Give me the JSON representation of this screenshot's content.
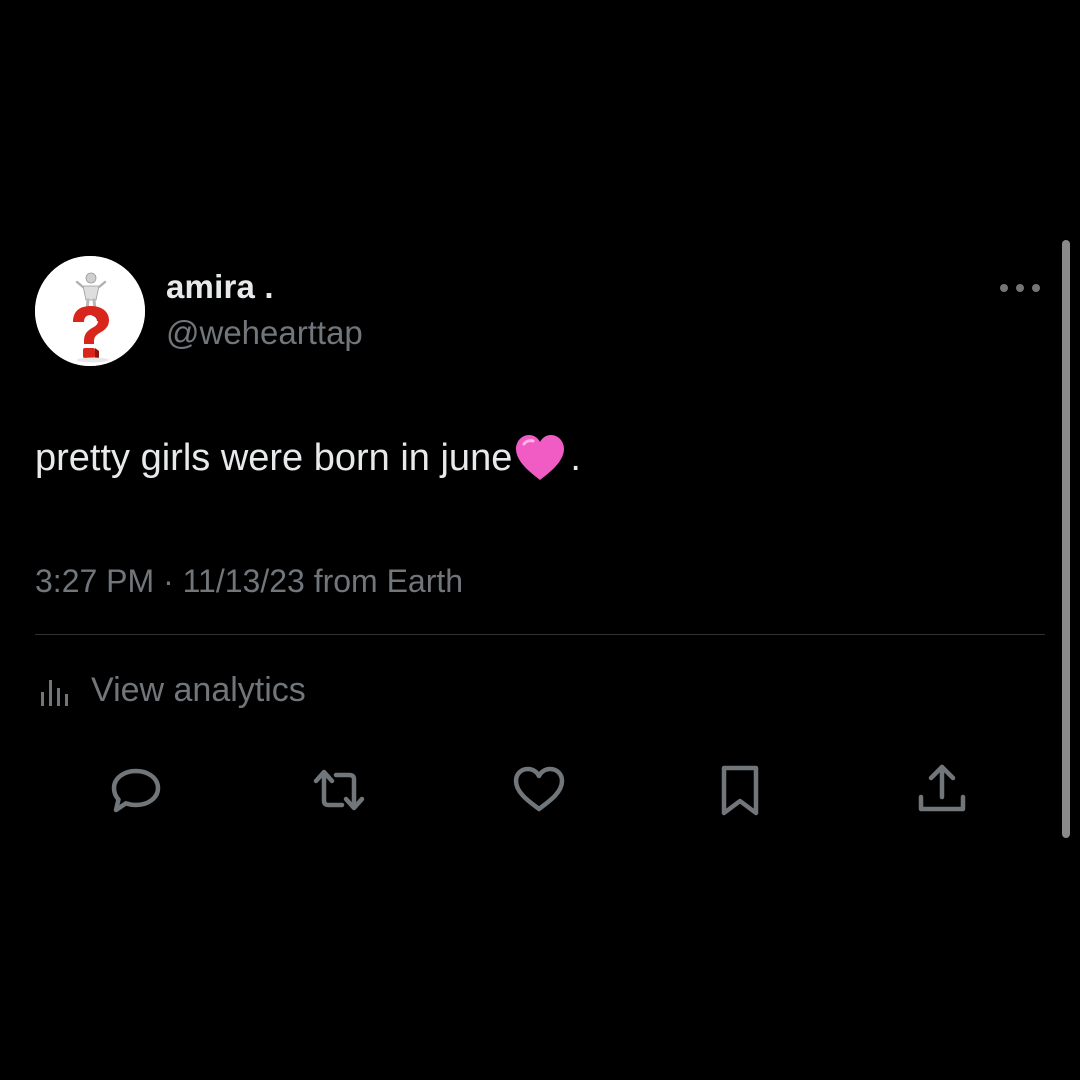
{
  "user": {
    "display_name": "amira .",
    "handle": "@wehearttap"
  },
  "tweet": {
    "text": "pretty girls were born in june",
    "emoji": "pink-heart",
    "trailing": ".",
    "time": "3:27 PM",
    "separator": "·",
    "date": "11/13/23",
    "source": "from Earth"
  },
  "analytics": {
    "label": "View analytics"
  },
  "actions": [
    {
      "name": "reply",
      "icon": "reply-icon"
    },
    {
      "name": "retweet",
      "icon": "retweet-icon"
    },
    {
      "name": "like",
      "icon": "heart-icon"
    },
    {
      "name": "bookmark",
      "icon": "bookmark-icon"
    },
    {
      "name": "share",
      "icon": "share-icon"
    }
  ],
  "colors": {
    "background": "#000000",
    "text_primary": "#e7e9ea",
    "text_secondary": "#71767b",
    "divider": "#2f3336",
    "emoji_heart": "#f05cc4",
    "avatar_question_mark": "#d9261c"
  }
}
